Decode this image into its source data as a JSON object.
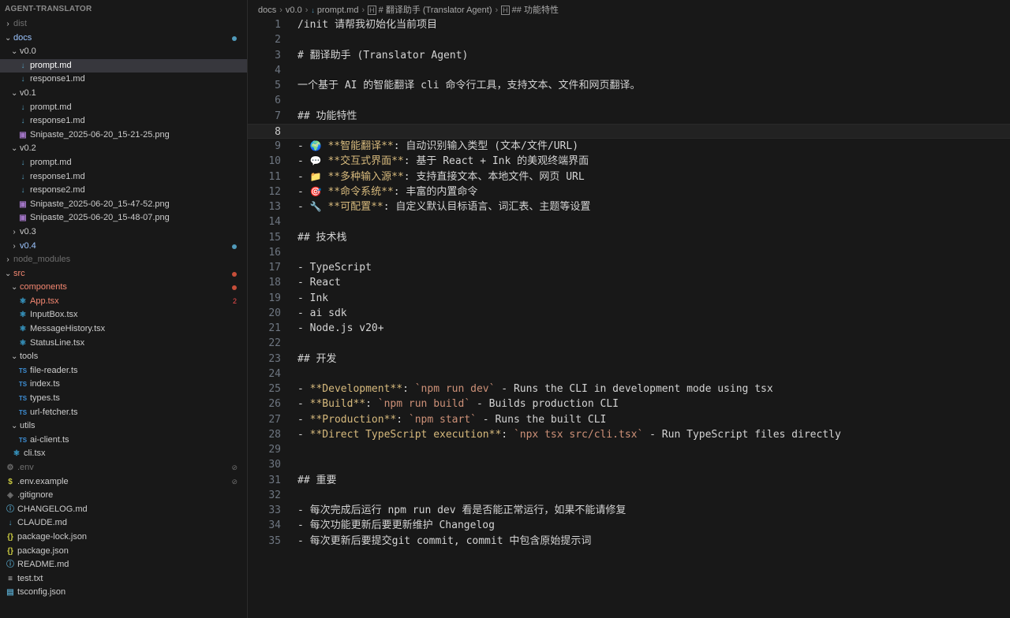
{
  "sidebar": {
    "title": "AGENT-TRANSLATOR",
    "tree": [
      {
        "depth": 0,
        "type": "folder",
        "open": false,
        "label": "dist",
        "color": "dim"
      },
      {
        "depth": 0,
        "type": "folder",
        "open": true,
        "label": "docs",
        "color": "blue",
        "dot": "#519aba"
      },
      {
        "depth": 1,
        "type": "folder",
        "open": true,
        "label": "v0.0"
      },
      {
        "depth": 2,
        "type": "md",
        "label": "prompt.md",
        "selected": true
      },
      {
        "depth": 2,
        "type": "md",
        "label": "response1.md"
      },
      {
        "depth": 1,
        "type": "folder",
        "open": true,
        "label": "v0.1"
      },
      {
        "depth": 2,
        "type": "md",
        "label": "prompt.md"
      },
      {
        "depth": 2,
        "type": "md",
        "label": "response1.md"
      },
      {
        "depth": 2,
        "type": "png",
        "label": "Snipaste_2025-06-20_15-21-25.png"
      },
      {
        "depth": 1,
        "type": "folder",
        "open": true,
        "label": "v0.2"
      },
      {
        "depth": 2,
        "type": "md",
        "label": "prompt.md"
      },
      {
        "depth": 2,
        "type": "md",
        "label": "response1.md"
      },
      {
        "depth": 2,
        "type": "md",
        "label": "response2.md"
      },
      {
        "depth": 2,
        "type": "png",
        "label": "Snipaste_2025-06-20_15-47-52.png"
      },
      {
        "depth": 2,
        "type": "png",
        "label": "Snipaste_2025-06-20_15-48-07.png"
      },
      {
        "depth": 1,
        "type": "folder",
        "open": false,
        "label": "v0.3"
      },
      {
        "depth": 1,
        "type": "folder",
        "open": false,
        "label": "v0.4",
        "color": "blue",
        "dot": "#519aba"
      },
      {
        "depth": 0,
        "type": "folder",
        "open": false,
        "label": "node_modules",
        "color": "dim"
      },
      {
        "depth": 0,
        "type": "folder",
        "open": true,
        "label": "src",
        "color": "red",
        "dot": "#c74e39"
      },
      {
        "depth": 1,
        "type": "folder",
        "open": true,
        "label": "components",
        "color": "red",
        "dot": "#c74e39"
      },
      {
        "depth": 2,
        "type": "react",
        "label": "App.tsx",
        "color": "red",
        "badge": "2"
      },
      {
        "depth": 2,
        "type": "react",
        "label": "InputBox.tsx"
      },
      {
        "depth": 2,
        "type": "react",
        "label": "MessageHistory.tsx"
      },
      {
        "depth": 2,
        "type": "react",
        "label": "StatusLine.tsx"
      },
      {
        "depth": 1,
        "type": "folder",
        "open": true,
        "label": "tools"
      },
      {
        "depth": 2,
        "type": "ts",
        "label": "file-reader.ts"
      },
      {
        "depth": 2,
        "type": "ts",
        "label": "index.ts"
      },
      {
        "depth": 2,
        "type": "ts",
        "label": "types.ts"
      },
      {
        "depth": 2,
        "type": "ts",
        "label": "url-fetcher.ts"
      },
      {
        "depth": 1,
        "type": "folder",
        "open": true,
        "label": "utils"
      },
      {
        "depth": 2,
        "type": "ts",
        "label": "ai-client.ts"
      },
      {
        "depth": 1,
        "type": "react",
        "label": "cli.tsx"
      },
      {
        "depth": 0,
        "type": "gear",
        "label": ".env",
        "color": "dim",
        "tag": "⊘"
      },
      {
        "depth": 0,
        "type": "dollar",
        "label": ".env.example",
        "tag": "⊘"
      },
      {
        "depth": 0,
        "type": "git",
        "label": ".gitignore"
      },
      {
        "depth": 0,
        "type": "info",
        "label": "CHANGELOG.md"
      },
      {
        "depth": 0,
        "type": "md",
        "label": "CLAUDE.md"
      },
      {
        "depth": 0,
        "type": "json",
        "label": "package-lock.json"
      },
      {
        "depth": 0,
        "type": "json",
        "label": "package.json"
      },
      {
        "depth": 0,
        "type": "info",
        "label": "README.md"
      },
      {
        "depth": 0,
        "type": "txt",
        "label": "test.txt"
      },
      {
        "depth": 0,
        "type": "tsconfig",
        "label": "tsconfig.json"
      }
    ]
  },
  "breadcrumb": {
    "items": [
      "docs",
      "v0.0",
      "prompt.md",
      "# 翻译助手 (Translator Agent)",
      "## 功能特性"
    ]
  },
  "editor": {
    "current_line": 8,
    "lines": [
      [
        {
          "t": "/init 请帮我初始化当前项目"
        }
      ],
      [],
      [
        {
          "t": "# 翻译助手 (Translator Agent)"
        }
      ],
      [],
      [
        {
          "t": "一个基于 AI 的智能翻译 cli 命令行工具，支持文本、文件和网页翻译。"
        }
      ],
      [],
      [
        {
          "t": "## 功能特性"
        }
      ],
      [],
      [
        {
          "t": "- "
        },
        {
          "t": "🌍",
          "s": "emoji"
        },
        {
          "t": " "
        },
        {
          "t": "**智能翻译**",
          "s": "bold"
        },
        {
          "t": ": 自动识别输入类型 (文本/文件/URL)"
        }
      ],
      [
        {
          "t": "- "
        },
        {
          "t": "💬",
          "s": "emoji"
        },
        {
          "t": " "
        },
        {
          "t": "**交互式界面**",
          "s": "bold"
        },
        {
          "t": ": 基于 React + Ink 的美观终端界面"
        }
      ],
      [
        {
          "t": "- "
        },
        {
          "t": "📁",
          "s": "emoji"
        },
        {
          "t": " "
        },
        {
          "t": "**多种输入源**",
          "s": "bold"
        },
        {
          "t": ": 支持直接文本、本地文件、网页 URL"
        }
      ],
      [
        {
          "t": "- "
        },
        {
          "t": "🎯",
          "s": "emoji"
        },
        {
          "t": " "
        },
        {
          "t": "**命令系统**",
          "s": "bold"
        },
        {
          "t": ": 丰富的内置命令"
        }
      ],
      [
        {
          "t": "- "
        },
        {
          "t": "🔧",
          "s": "emoji"
        },
        {
          "t": " "
        },
        {
          "t": "**可配置**",
          "s": "bold"
        },
        {
          "t": ": 自定义默认目标语言、词汇表、主题等设置"
        }
      ],
      [],
      [
        {
          "t": "## 技术栈"
        }
      ],
      [],
      [
        {
          "t": "- TypeScript"
        }
      ],
      [
        {
          "t": "- React"
        }
      ],
      [
        {
          "t": "- Ink"
        }
      ],
      [
        {
          "t": "- ai sdk"
        }
      ],
      [
        {
          "t": "- Node.js v20+"
        }
      ],
      [],
      [
        {
          "t": "## 开发"
        }
      ],
      [],
      [
        {
          "t": "- "
        },
        {
          "t": "**Development**",
          "s": "bold"
        },
        {
          "t": ": "
        },
        {
          "t": "`npm run dev`",
          "s": "inl"
        },
        {
          "t": " - Runs the CLI in development mode using tsx"
        }
      ],
      [
        {
          "t": "- "
        },
        {
          "t": "**Build**",
          "s": "bold"
        },
        {
          "t": ": "
        },
        {
          "t": "`npm run build`",
          "s": "inl"
        },
        {
          "t": " - Builds production CLI"
        }
      ],
      [
        {
          "t": "- "
        },
        {
          "t": "**Production**",
          "s": "bold"
        },
        {
          "t": ": "
        },
        {
          "t": "`npm start`",
          "s": "inl"
        },
        {
          "t": " - Runs the built CLI"
        }
      ],
      [
        {
          "t": "- "
        },
        {
          "t": "**Direct TypeScript execution**",
          "s": "bold"
        },
        {
          "t": ": "
        },
        {
          "t": "`npx tsx src/cli.tsx`",
          "s": "inl"
        },
        {
          "t": " - Run TypeScript files directly"
        }
      ],
      [],
      [],
      [
        {
          "t": "## 重要"
        }
      ],
      [],
      [
        {
          "t": "- 每次完成后运行 npm run dev 看是否能正常运行，如果不能请修复"
        }
      ],
      [
        {
          "t": "- 每次功能更新后要更新维护 Changelog"
        }
      ],
      [
        {
          "t": "- 每次更新后要提交git commit, commit 中包含原始提示词"
        }
      ]
    ]
  },
  "icons": {
    "md": "↓",
    "png": "▣",
    "ts": "TS",
    "react": "⚛",
    "json": "{}",
    "gear": "⚙",
    "dollar": "$",
    "git": "◈",
    "info": "ⓘ",
    "txt": "≡",
    "tsconfig": "▤"
  }
}
